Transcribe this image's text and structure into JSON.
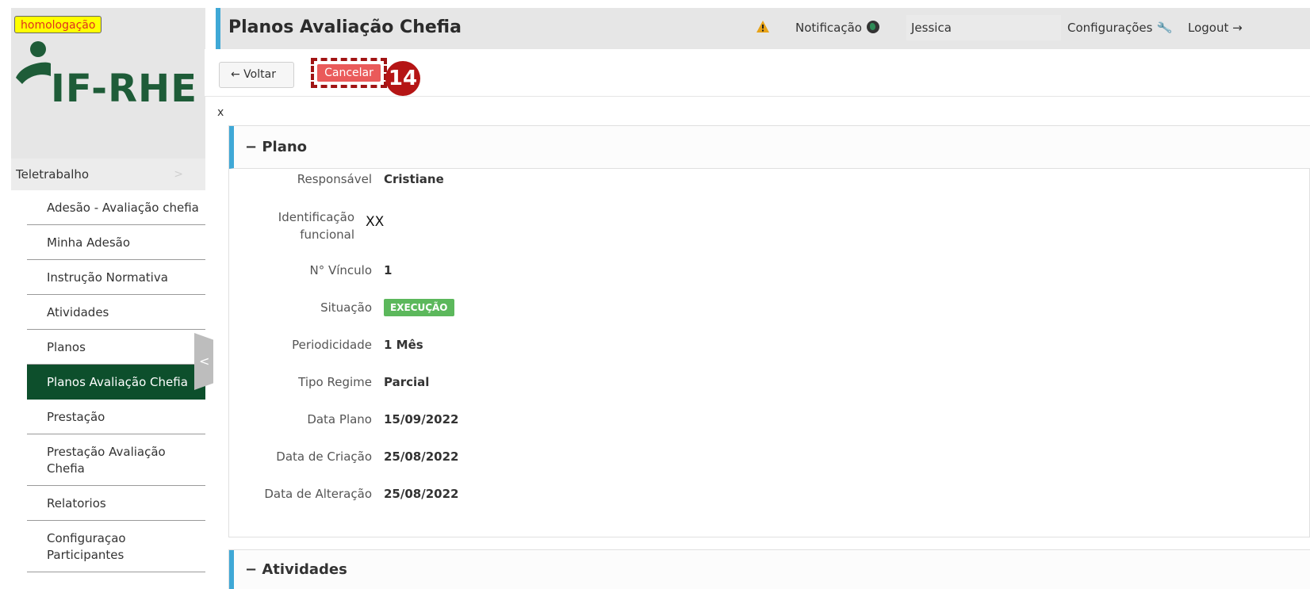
{
  "env_badge": "homologação",
  "logo": {
    "text": "IF-RHE",
    "brand_color": "#1e5c38"
  },
  "sidebar": {
    "section": "Teletrabalho",
    "items": [
      {
        "label": "Adesão - Avaliação chefia"
      },
      {
        "label": "Minha Adesão"
      },
      {
        "label": "Instrução Normativa"
      },
      {
        "label": "Atividades"
      },
      {
        "label": "Planos"
      },
      {
        "label": "Planos Avaliação Chefia",
        "active": true
      },
      {
        "label": "Prestação"
      },
      {
        "label": "Prestação Avaliação Chefia"
      },
      {
        "label": "Relatorios"
      },
      {
        "label": "Configuraçao Participantes"
      }
    ]
  },
  "header": {
    "title": "Planos Avaliação Chefia",
    "notification_label": "Notificação",
    "user_name": "Jessica",
    "settings_label": "Configurações",
    "logout_label": "Logout →"
  },
  "toolbar": {
    "back_label": "← Voltar",
    "cancel_label": "Cancelar",
    "step_number": "14"
  },
  "stray_text": "x",
  "plano": {
    "title": "− Plano",
    "fields": [
      {
        "label": "Responsável",
        "value": "Cristiane"
      },
      {
        "label": "Identificação funcional",
        "value": "XX"
      },
      {
        "label": "N° Vínculo",
        "value": "1"
      },
      {
        "label": "Situação",
        "value": "EXECUÇÃO"
      },
      {
        "label": "Periodicidade",
        "value": "1 Mês"
      },
      {
        "label": "Tipo Regime",
        "value": "Parcial"
      },
      {
        "label": "Data Plano",
        "value": "15/09/2022"
      },
      {
        "label": "Data de Criação",
        "value": "25/08/2022"
      },
      {
        "label": "Data de Alteração",
        "value": "25/08/2022"
      }
    ]
  },
  "atividades": {
    "title": "− Atividades"
  },
  "colors": {
    "accent": "#3fa8d6",
    "active_menu": "#0d4f2c",
    "cancel_button": "#ea5a5a",
    "status_green": "#5cb85c",
    "step_badge": "#b51515"
  }
}
